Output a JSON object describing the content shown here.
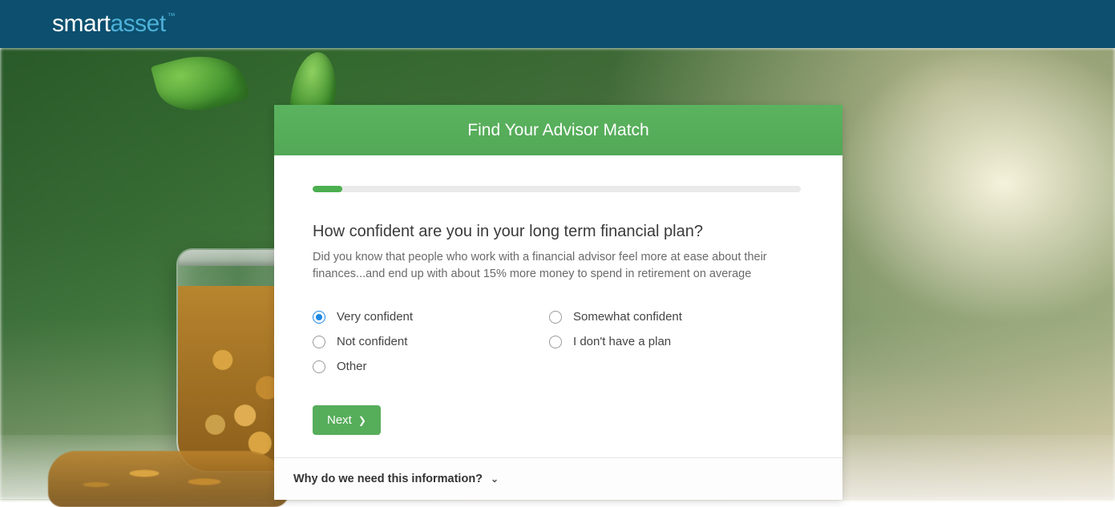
{
  "brand": {
    "part1": "smart",
    "part2": "asset",
    "tm": "™"
  },
  "card": {
    "title": "Find Your Advisor Match",
    "progress_percent": 6,
    "question": "How confident are you in your long term financial plan?",
    "subtext": "Did you know that people who work with a financial advisor feel more at ease about their finances...and end up with about 15% more money to spend in retirement on average",
    "options": [
      {
        "label": "Very confident",
        "selected": true
      },
      {
        "label": "Somewhat confident",
        "selected": false
      },
      {
        "label": "Not confident",
        "selected": false
      },
      {
        "label": "I don't have a plan",
        "selected": false
      },
      {
        "label": "Other",
        "selected": false
      }
    ],
    "next_label": "Next",
    "footer_label": "Why do we need this information?"
  }
}
